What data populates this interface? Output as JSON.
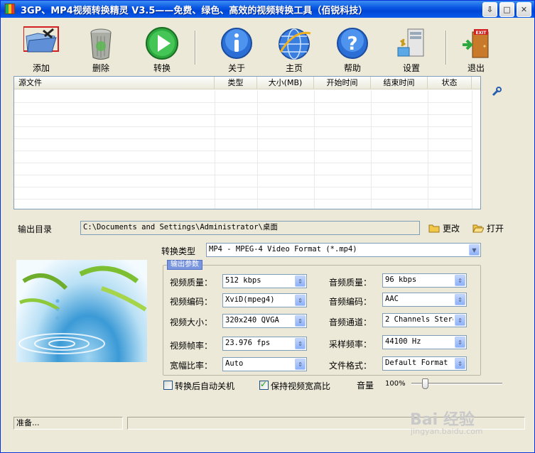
{
  "window": {
    "title": "3GP、MP4视频转换精灵 V3.5——免费、绿色、高效的视频转换工具（佰锐科技）"
  },
  "titlebar": {
    "min_glyph": "⇩",
    "max_glyph": "□",
    "close_glyph": "✕"
  },
  "toolbar": [
    {
      "label": "添加",
      "icon": "add-folder-icon"
    },
    {
      "label": "删除",
      "icon": "trash-can-icon"
    },
    {
      "label": "转换",
      "icon": "play-icon"
    },
    {
      "label": "关于",
      "icon": "info-icon"
    },
    {
      "label": "主页",
      "icon": "globe-icon"
    },
    {
      "label": "帮助",
      "icon": "help-icon"
    },
    {
      "label": "设置",
      "icon": "settings-icon"
    },
    {
      "label": "退出",
      "icon": "exit-door-icon"
    }
  ],
  "exit_sign": "EXIT",
  "file_list": {
    "columns": [
      "源文件",
      "类型",
      "大小(MB)",
      "开始时间",
      "结束时间",
      "状态"
    ],
    "rows": []
  },
  "output": {
    "label": "输出目录",
    "path": "C:\\Documents and Settings\\Administrator\\桌面",
    "change_label": "更改",
    "open_label": "打开"
  },
  "convert_type": {
    "label": "转换类型",
    "value": "MP4 - MPEG-4 Video Format (*.mp4)"
  },
  "params": {
    "group_title": "输出参数",
    "video_quality": {
      "label": "视频质量：",
      "value": "512 kbps"
    },
    "video_codec": {
      "label": "视频编码：",
      "value": "XviD(mpeg4)"
    },
    "video_size": {
      "label": "视频大小：",
      "value": "320x240 QVGA"
    },
    "frame_rate": {
      "label": "视频帧率：",
      "value": "23.976 fps"
    },
    "aspect": {
      "label": "宽幅比率：",
      "value": "Auto"
    },
    "audio_quality": {
      "label": "音频质量：",
      "value": "96  kbps"
    },
    "audio_codec": {
      "label": "音频编码：",
      "value": "AAC"
    },
    "audio_channel": {
      "label": "音频通道：",
      "value": "2 Channels Stere"
    },
    "sample_rate": {
      "label": "采样频率：",
      "value": "44100 Hz"
    },
    "file_format": {
      "label": "文件格式：",
      "value": "Default Format"
    }
  },
  "options": {
    "auto_shutdown": {
      "label": "转换后自动关机",
      "checked": false
    },
    "keep_aspect": {
      "label": "保持视频宽高比",
      "checked": true
    },
    "volume_label": "音量",
    "volume_value": "100%",
    "volume_fraction": 0.15
  },
  "status": {
    "text": "准备..."
  },
  "watermark": {
    "brand": "Bai 经验",
    "url": "jingyan.baidu.com"
  }
}
